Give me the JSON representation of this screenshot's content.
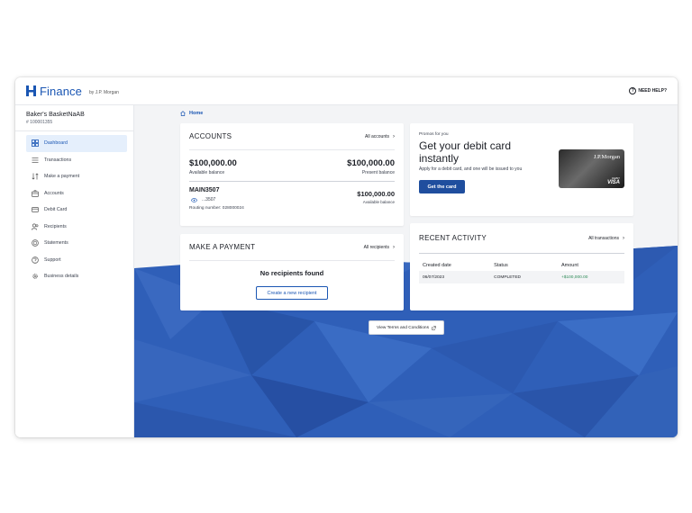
{
  "header": {
    "logo_text": "Finance",
    "logo_sub": "by J.P. Morgan",
    "help_label": "NEED HELP?"
  },
  "sidebar": {
    "account_name": "Baker's BasketNaAB",
    "account_number": "# 100001355",
    "items": [
      {
        "label": "Dashboard",
        "icon": "dashboard-icon",
        "active": true
      },
      {
        "label": "Transactions",
        "icon": "list-icon"
      },
      {
        "label": "Make a payment",
        "icon": "payment-arrows-icon"
      },
      {
        "label": "Accounts",
        "icon": "bank-icon"
      },
      {
        "label": "Debit Card",
        "icon": "card-icon"
      },
      {
        "label": "Recipients",
        "icon": "users-icon"
      },
      {
        "label": "Statements",
        "icon": "statement-icon"
      },
      {
        "label": "Support",
        "icon": "help-icon"
      },
      {
        "label": "Business details",
        "icon": "gear-icon"
      }
    ]
  },
  "breadcrumb": {
    "label": "Home"
  },
  "accounts": {
    "title": "ACCOUNTS",
    "link": "All accounts",
    "available_balance": "$100,000.00",
    "available_label": "Available balance",
    "present_balance": "$100,000.00",
    "present_label": "Present balance",
    "sub_name": "MAIN3507",
    "sub_mask": "...3507",
    "sub_balance": "$100,000.00",
    "sub_balance_label": "Available balance",
    "routing": "Routing number: 028000024"
  },
  "payment": {
    "title": "MAKE A PAYMENT",
    "link": "All recipients",
    "empty_text": "No recipients found",
    "button": "Create a new recipient"
  },
  "promo": {
    "eyebrow": "Promos for you",
    "title": "Get your debit card instantly",
    "description": "Apply for a debit card, and one will be issued to you",
    "button": "Get the card",
    "card_bank": "J.P.Morgan",
    "card_type": "DEBIT",
    "card_brand": "VISA"
  },
  "activity": {
    "title": "RECENT ACTIVITY",
    "link": "All transactions",
    "columns": [
      "Created date",
      "Status",
      "Amount"
    ],
    "rows": [
      {
        "date": "06/07/2023",
        "status": "COMPLETED",
        "amount": "+$100,000.00"
      }
    ]
  },
  "terms": {
    "label": "View Terms and Conditions"
  },
  "colors": {
    "accent": "#1a56b3",
    "background_pattern": "#2f5fb8",
    "success": "#2e8b57"
  }
}
